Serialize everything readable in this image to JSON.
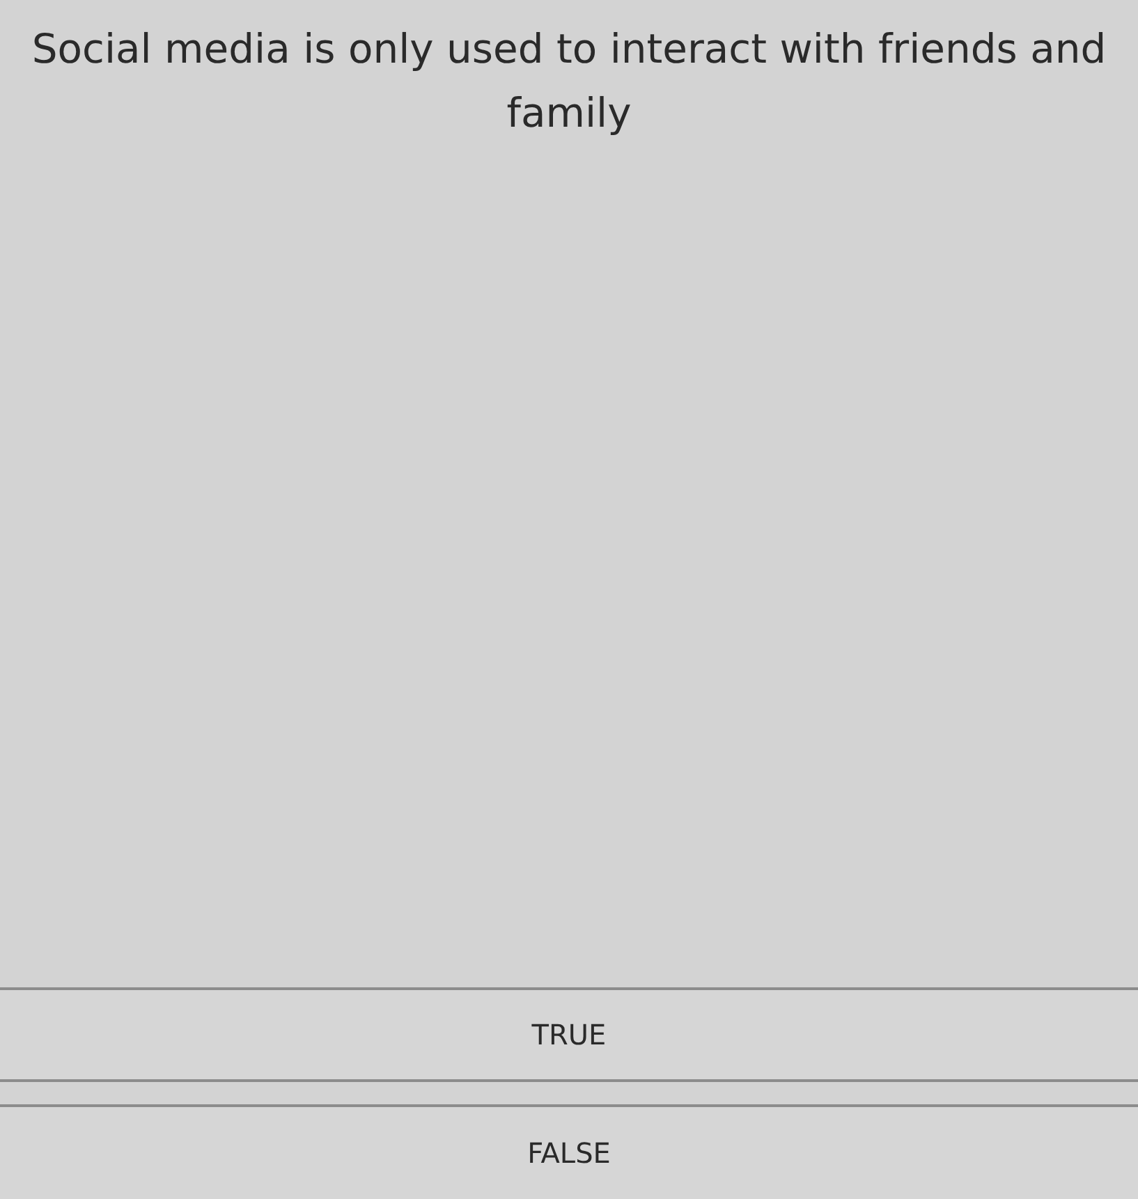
{
  "question": {
    "text": "Social media is only used to interact with friends and family"
  },
  "options": [
    {
      "label": "TRUE",
      "selected": false
    },
    {
      "label": "FALSE",
      "selected": false
    }
  ]
}
